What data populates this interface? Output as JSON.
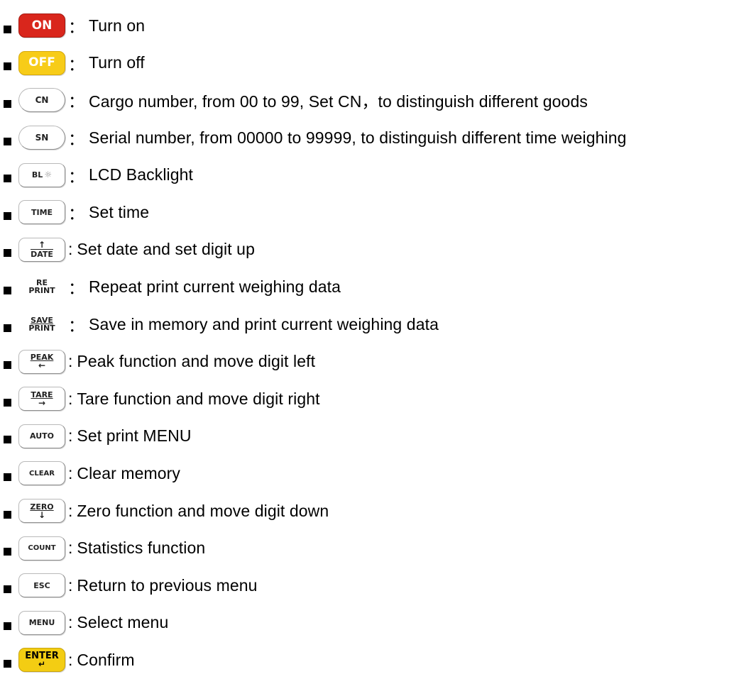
{
  "items": [
    {
      "key": "ON",
      "sep": "：",
      "text": "Turn on"
    },
    {
      "key": "OFF",
      "sep": "：",
      "text": "Turn off"
    },
    {
      "key": "CN",
      "sep": "：",
      "text": "Cargo number, from 00 to 99, Set CN，to distinguish different goods"
    },
    {
      "key": "SN",
      "sep": "：",
      "text": "Serial number, from 00000 to 99999, to distinguish different time weighing"
    },
    {
      "key": "BL",
      "sep": "：",
      "text": "LCD Backlight"
    },
    {
      "key": "TIME",
      "sep": "：",
      "text": "Set time"
    },
    {
      "key_top": "↑",
      "key": "DATE",
      "sep": ":",
      "text": "Set date and set digit up"
    },
    {
      "key_top": "RE",
      "key": "PRINT",
      "sep": "：",
      "text": "Repeat print current weighing data"
    },
    {
      "key_top": "SAVE",
      "key": "PRINT",
      "sep": "：",
      "text": "Save in memory and print current weighing data"
    },
    {
      "key": "PEAK",
      "key_bottom": "←",
      "sep": ":",
      "text": "Peak function and move digit left"
    },
    {
      "key": "TARE",
      "key_bottom": "→",
      "sep": ":",
      "text": "Tare function and move digit right"
    },
    {
      "key": "AUTO",
      "sep": ":",
      "text": "Set print MENU"
    },
    {
      "key": "CLEAR",
      "sep": ":",
      "text": "Clear memory"
    },
    {
      "key": "ZERO",
      "key_bottom": "↓",
      "sep": ":",
      "text": "Zero function and move digit down"
    },
    {
      "key": "COUNT",
      "sep": ":",
      "text": "Statistics function"
    },
    {
      "key": "ESC",
      "sep": ":",
      "text": "Return to previous menu"
    },
    {
      "key": "MENU",
      "sep": ":",
      "text": "Select menu"
    },
    {
      "key": "ENTER",
      "key_bottom": "↵",
      "sep": ":",
      "text": "Confirm"
    }
  ],
  "icons": {
    "bullet": "black-square-bullet-icon",
    "backlight": "sun-icon"
  },
  "colors": {
    "on_key": "#d9261c",
    "off_key": "#f7cc18",
    "enter_key": "#f3cd13"
  }
}
